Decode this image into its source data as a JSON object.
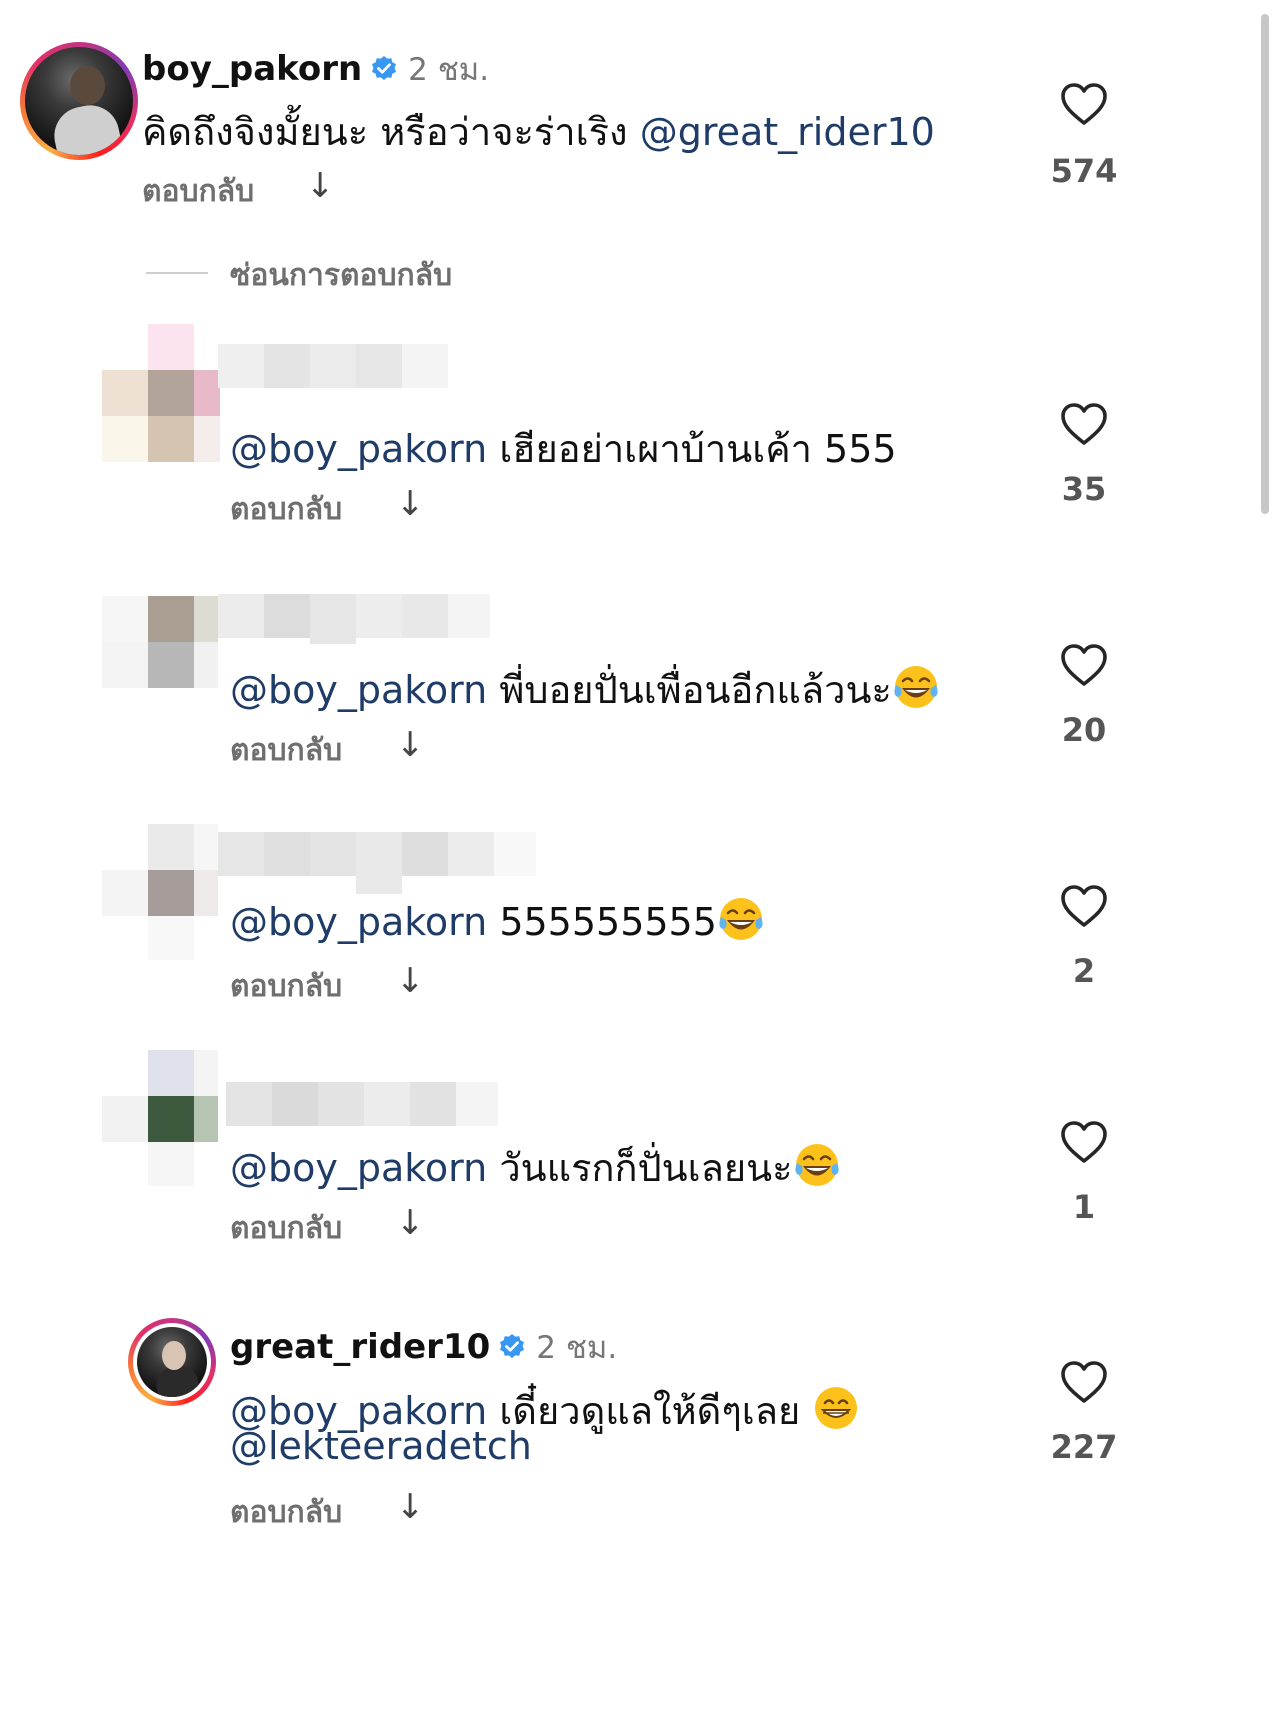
{
  "main_comment": {
    "username": "boy_pakorn",
    "time": "2 ชม.",
    "text": "คิดถึงจิงมั้ยนะ หรือว่าจะร่าเริง",
    "mention": "@great_rider10",
    "reply_label": "ตอบกลับ",
    "likes": "574"
  },
  "hide_replies_label": "ซ่อนการตอบกลับ",
  "replies": [
    {
      "mention": "@boy_pakorn",
      "text": "เฮียอย่าเผาบ้านเค้า 555",
      "emoji": "",
      "reply_label": "ตอบกลับ",
      "likes": "35"
    },
    {
      "mention": "@boy_pakorn",
      "text": "พี่บอยปั่นเพื่อนอีกแล้วนะ",
      "emoji": "face-with-tears-of-joy",
      "reply_label": "ตอบกลับ",
      "likes": "20"
    },
    {
      "mention": "@boy_pakorn",
      "text": "555555555",
      "emoji": "face-with-tears-of-joy",
      "reply_label": "ตอบกลับ",
      "likes": "2"
    },
    {
      "mention": "@boy_pakorn",
      "text": "วันแรกก็ปั่นเลยนะ",
      "emoji": "face-with-tears-of-joy",
      "reply_label": "ตอบกลับ",
      "likes": "1"
    }
  ],
  "last_reply": {
    "username": "great_rider10",
    "time": "2 ชม.",
    "mention": "@boy_pakorn",
    "text": "เดี๋ยวดูแลให้ดีๆเลย",
    "emoji": "grinning-face",
    "mention2": "@lekteeradetch",
    "reply_label": "ตอบกลับ",
    "likes": "227"
  },
  "colors": {
    "mention": "#1f3b67",
    "verified": "#3897f0",
    "text": "#111111",
    "muted": "#6f6f6f"
  },
  "icons": [
    "verified-badge-icon",
    "heart-icon",
    "arrow-down-icon",
    "face-with-tears-of-joy",
    "grinning-face"
  ]
}
